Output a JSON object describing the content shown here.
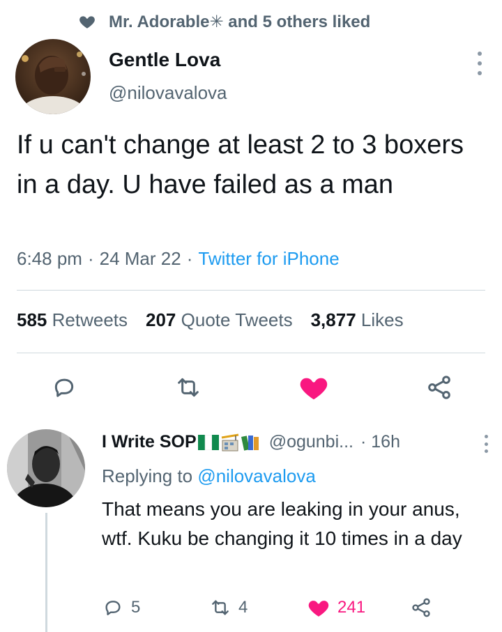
{
  "social_context": {
    "text": "Mr. Adorable✳ and 5 others liked"
  },
  "tweet": {
    "author_name": "Gentle Lova",
    "author_handle": "@nilovavalova",
    "text": "If u can't change at least 2 to 3 boxers in a day. U have failed as a man",
    "time": "6:48 pm",
    "date": "24 Mar 22",
    "separator": "·",
    "source": "Twitter for iPhone",
    "stats": {
      "retweets": "585",
      "retweets_label": "Retweets",
      "quotes": "207",
      "quotes_label": "Quote Tweets",
      "likes": "3,877",
      "likes_label": "Likes"
    },
    "liked": true
  },
  "reply": {
    "author_name": "I Write SOP",
    "author_handle": "@ogunbi...",
    "time": "· 16h",
    "replying_prefix": "Replying to",
    "replying_mention": "@nilovavalova",
    "text": "That means you are leaking in your anus, wtf. Kuku be changing it 10 times in a day",
    "reply_count": "5",
    "retweet_count": "4",
    "like_count": "241",
    "liked": true
  },
  "icons": {
    "like_filled": "heart-icon",
    "reply": "reply-icon",
    "retweet": "retweet-icon",
    "share": "share-icon",
    "more": "more-icon"
  },
  "colors": {
    "text_primary": "#0f1419",
    "text_secondary": "#536471",
    "link": "#1d9bf0",
    "like": "#f91880",
    "divider": "#cfd9de"
  }
}
